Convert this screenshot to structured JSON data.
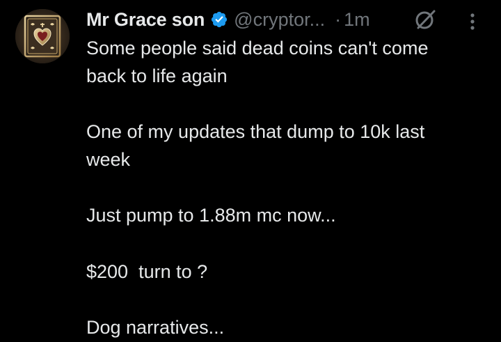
{
  "tweet": {
    "author": {
      "display_name": "Mr Grace son",
      "handle": "@cryptor...",
      "verified": true,
      "avatar_icon": "ornate-heart-card-icon"
    },
    "separator": "·",
    "timestamp": "1m",
    "paragraphs": [
      [
        "Some people said dead coins can't come",
        "back to life again"
      ],
      [
        "One of my updates that dump to 10k last",
        "week"
      ],
      [
        "Just pump to 1.88m mc now..."
      ],
      [
        "$200  turn to ?"
      ],
      [
        "Dog narratives..."
      ]
    ]
  },
  "icons": {
    "verified": "verified-badge-icon",
    "grok": "grok-icon",
    "more": "more-options-icon"
  },
  "colors": {
    "background": "#000000",
    "primary_text": "#e7e9ea",
    "secondary_text": "#71767b",
    "verified_blue": "#1d9bf0"
  }
}
